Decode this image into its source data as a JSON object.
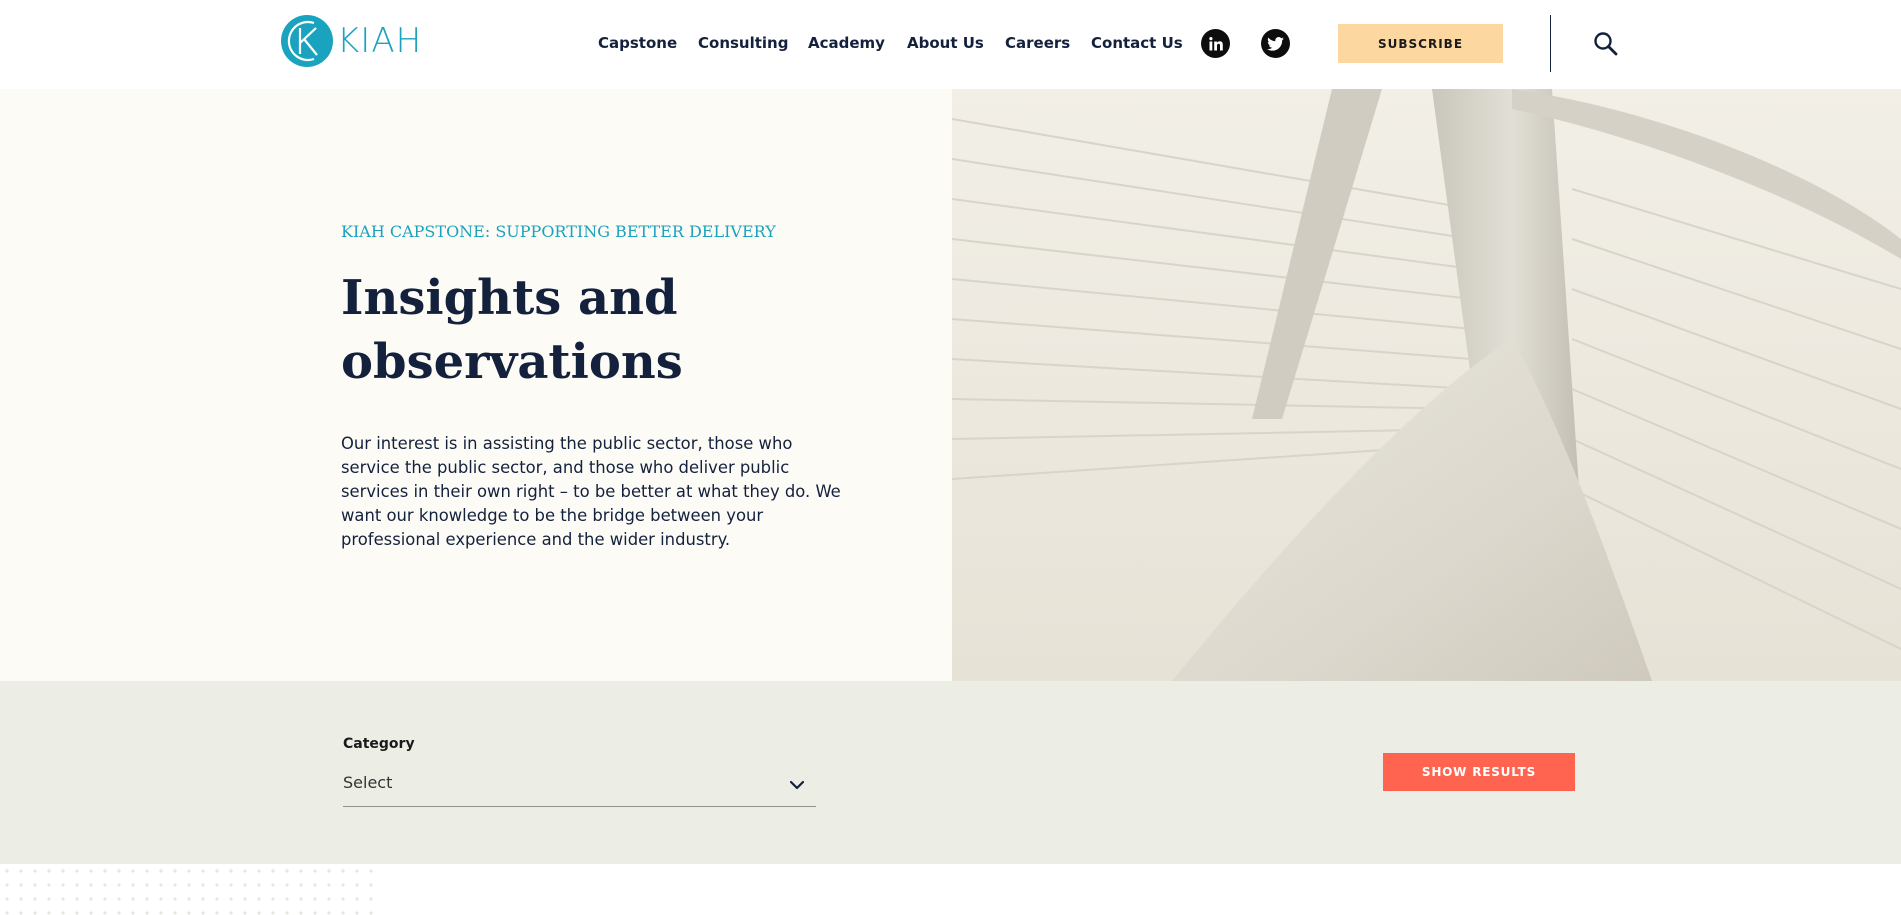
{
  "header": {
    "logo_text": "KIAH",
    "nav": [
      {
        "label": "Capstone"
      },
      {
        "label": "Consulting"
      },
      {
        "label": "Academy"
      },
      {
        "label": "About Us"
      },
      {
        "label": "Careers"
      },
      {
        "label": "Contact Us"
      }
    ],
    "social": [
      {
        "icon": "linkedin-icon"
      },
      {
        "icon": "twitter-icon"
      }
    ],
    "subscribe_label": "SUBSCRIBE",
    "search_icon": "search-icon"
  },
  "hero": {
    "eyebrow": "KIAH CAPSTONE: SUPPORTING BETTER DELIVERY",
    "title_line1": "Insights and",
    "title_line2": "observations",
    "body": "Our interest is in assisting the public sector, those who service the public sector, and those who deliver public services in their own right – to be better at what they do. We want our knowledge to be the bridge between your professional experience and the wider industry."
  },
  "filter": {
    "category_label": "Category",
    "select_value": "Select",
    "show_results_label": "SHOW RESULTS"
  },
  "colors": {
    "brand_teal": "#1aa3bf",
    "navy": "#14213d",
    "subscribe_bg": "#fdd7a0",
    "accent_coral": "#ff6450",
    "hero_bg": "#fcfbf6",
    "filter_bg": "#eceee6"
  }
}
